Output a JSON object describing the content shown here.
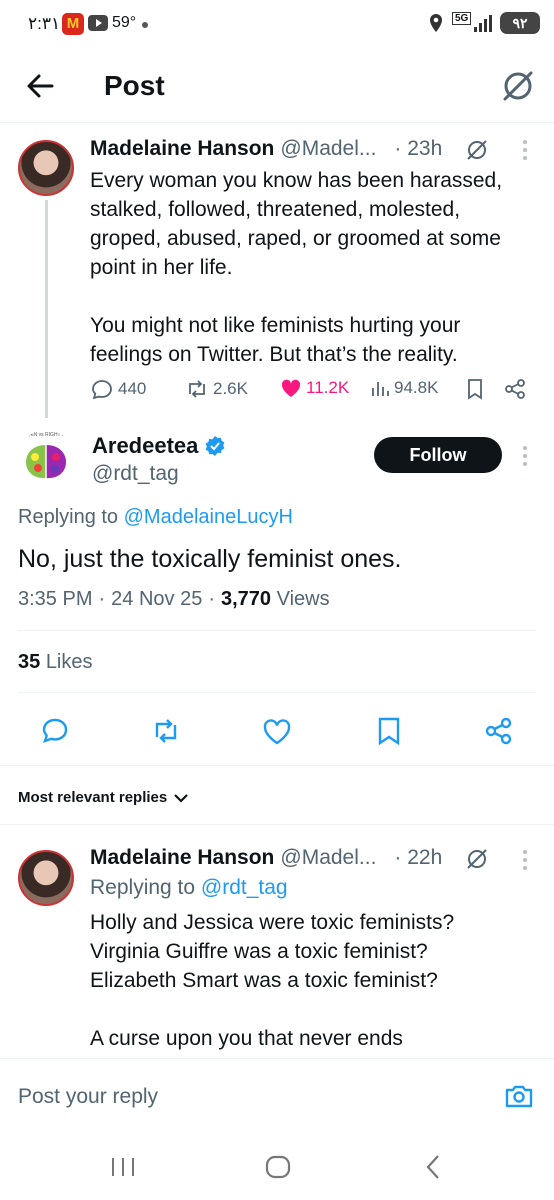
{
  "status_bar": {
    "time": "٢:٣١",
    "temperature": "59°",
    "battery": "٩٢"
  },
  "header": {
    "title": "Post"
  },
  "parent_post": {
    "name": "Madelaine Hanson",
    "handle": "@Madel...",
    "time": "· 23h",
    "text_lines": [
      "Every woman you know has been harassed,",
      "stalked, followed, threatened, molested,",
      "groped, abused, raped, or groomed at some",
      "point in her life.",
      "",
      "You might not like feminists hurting your",
      "feelings on Twitter. But that’s the reality."
    ],
    "replies": "440",
    "reposts": "2.6K",
    "likes": "11.2K",
    "views": "94.8K"
  },
  "main_post": {
    "avatar_text": "BRAIN vs RIGHT Brain",
    "name": "Aredeetea",
    "handle": "@rdt_tag",
    "follow_label": "Follow",
    "replying_to_prefix": "Replying to ",
    "replying_to_handle": "@MadelaineLucyH",
    "text": "No, just the toxically feminist ones.",
    "time": "3:35 PM",
    "date": "24 Nov 25",
    "views_count": "3,770",
    "views_label": "Views",
    "likes_count": "35",
    "likes_label": "Likes",
    "separator": "·"
  },
  "replies_section": {
    "sort_label": "Most relevant replies"
  },
  "reply": {
    "name": "Madelaine Hanson",
    "handle": "@Madel...",
    "time": "· 22h",
    "replying_to_prefix": "Replying to ",
    "replying_to_handle": "@rdt_tag",
    "text_lines": [
      "Holly and Jessica were toxic feminists?",
      "Virginia Guiffre was a toxic feminist?",
      "Elizabeth Smart was a toxic feminist?",
      "",
      "A curse upon you that never ends"
    ]
  },
  "composer": {
    "placeholder": "Post your reply"
  },
  "colors": {
    "accent": "#1d9bf0",
    "like": "#f91880",
    "verified": "#1d9bf0"
  }
}
